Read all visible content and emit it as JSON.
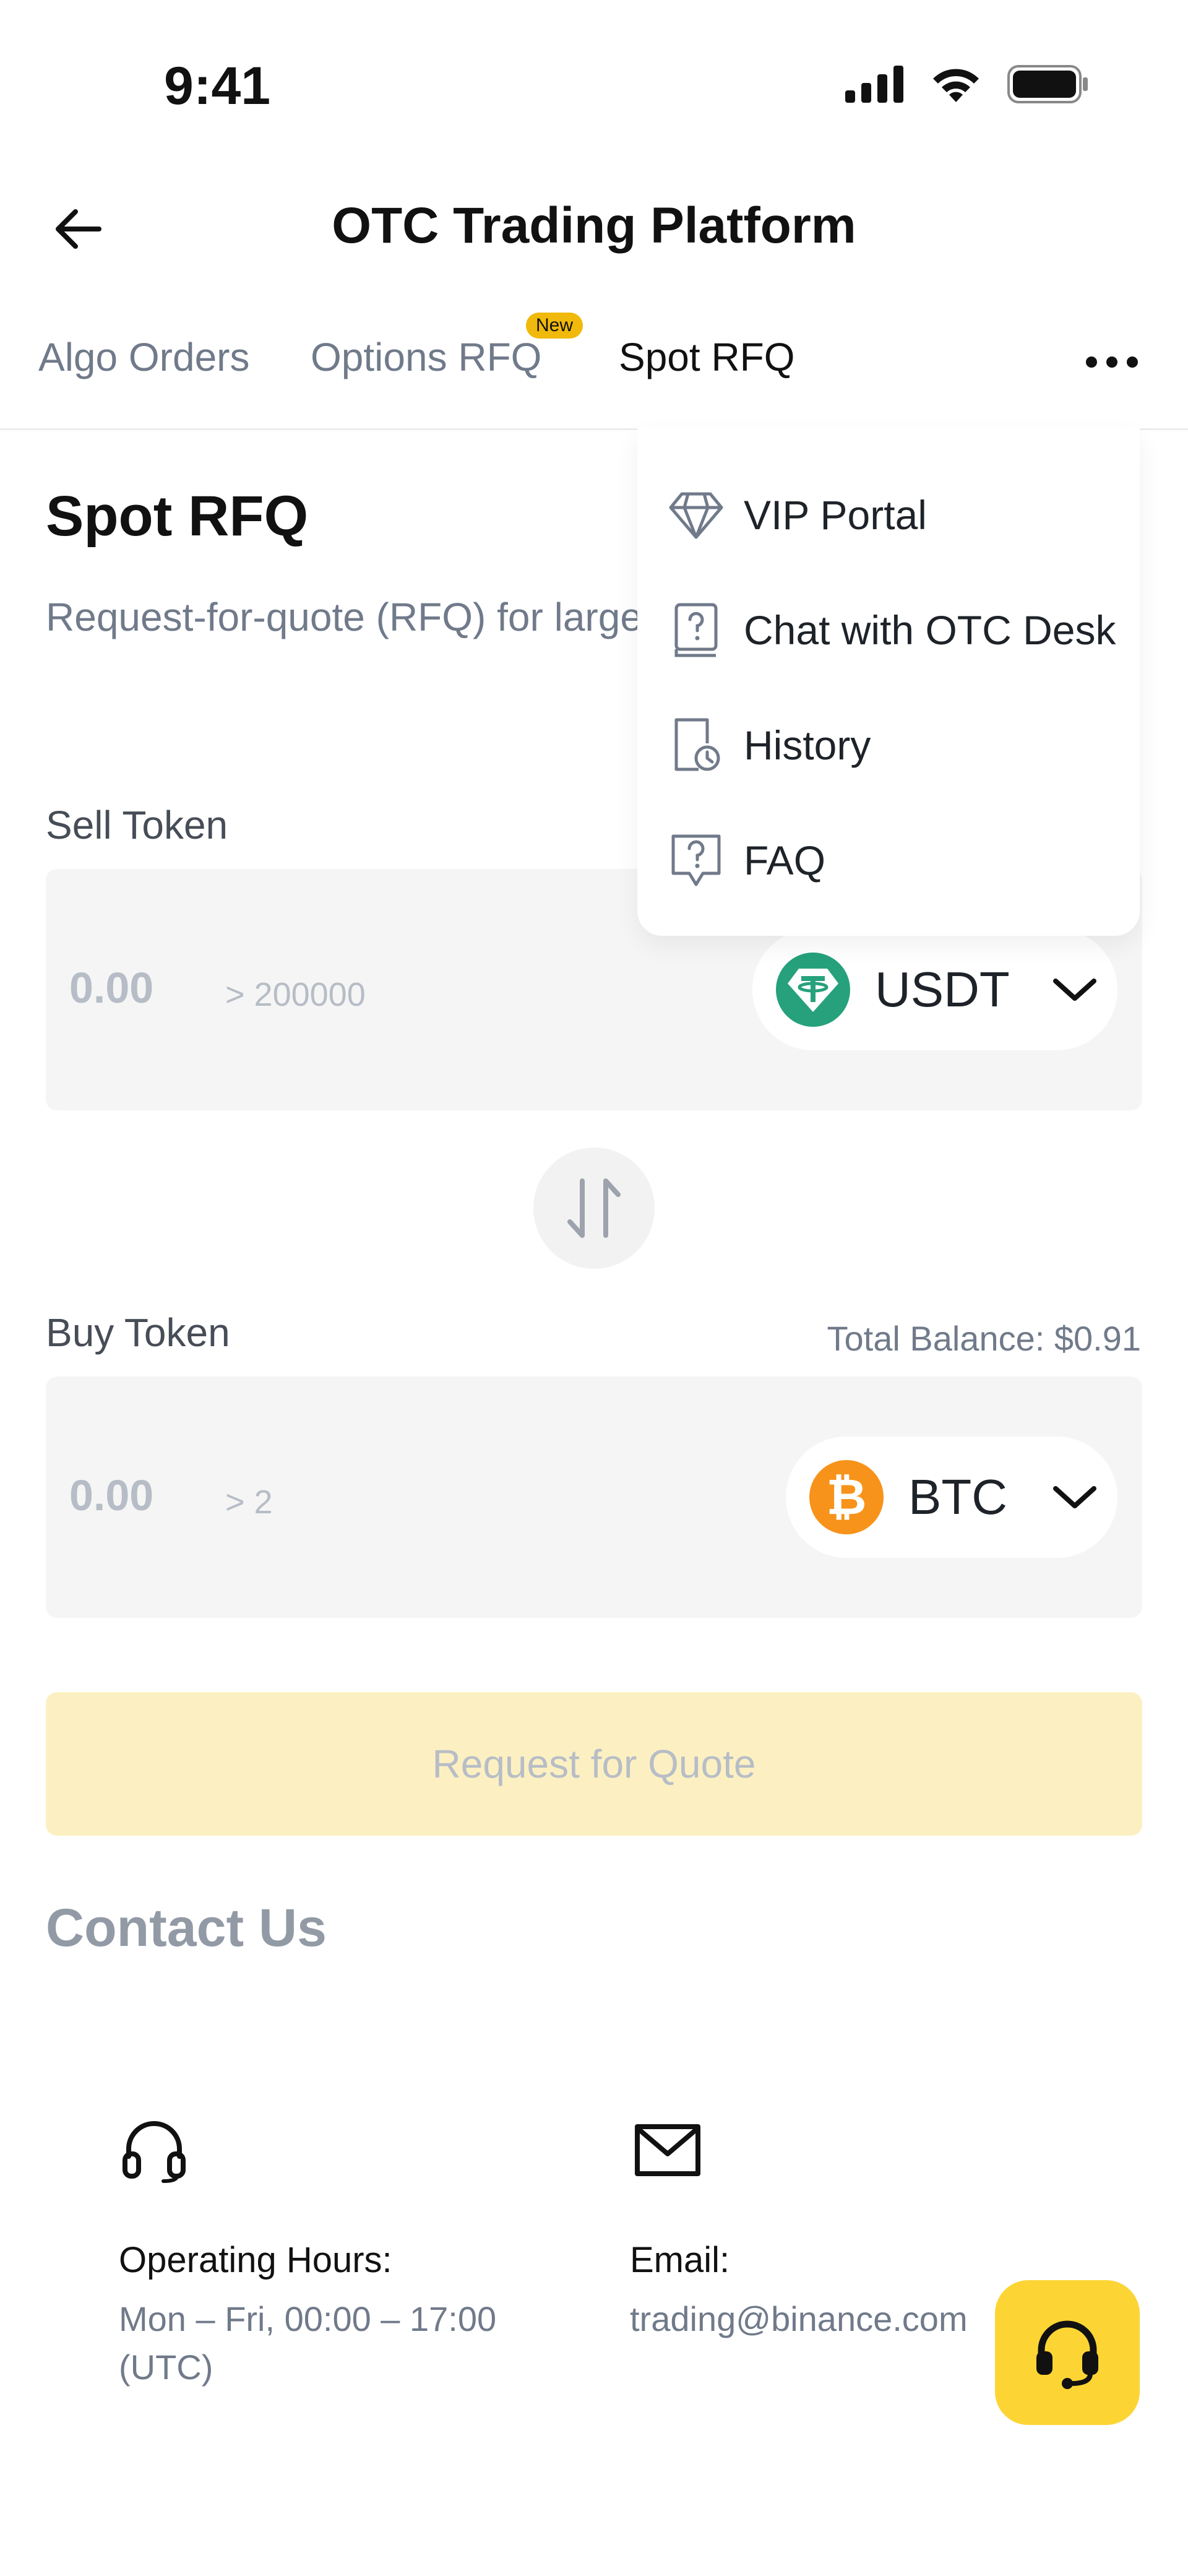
{
  "status_bar": {
    "time": "9:41"
  },
  "header": {
    "title": "OTC Trading Platform"
  },
  "tabs": [
    {
      "label": "Algo Orders"
    },
    {
      "label": "Options RFQ",
      "badge": "New"
    },
    {
      "label": "Spot RFQ"
    }
  ],
  "page": {
    "title": "Spot RFQ",
    "subtitle": "Request-for-quote (RFQ) for large"
  },
  "sell": {
    "label": "Sell Token",
    "amount": "0.00",
    "min_hint": "> 200000",
    "token": "USDT",
    "token_icon": "usdt-icon",
    "token_color": "#26a17b"
  },
  "buy": {
    "label": "Buy Token",
    "balance": "Total Balance: $0.91",
    "amount": "0.00",
    "min_hint": "> 2",
    "token": "BTC",
    "token_icon": "btc-icon",
    "token_color": "#f7931a"
  },
  "rfq_button": "Request for Quote",
  "contact": {
    "title": "Contact Us",
    "hours_label": "Operating Hours:",
    "hours_value_line1": "Mon – Fri, 00:00 – 17:00",
    "hours_value_line2": "(UTC)",
    "email_label": "Email:",
    "email_value": "trading@binance.com"
  },
  "menu": {
    "items": [
      {
        "label": "VIP Portal",
        "icon": "diamond-icon"
      },
      {
        "label": "Chat with OTC Desk",
        "icon": "chat-icon"
      },
      {
        "label": "History",
        "icon": "history-icon"
      },
      {
        "label": "FAQ",
        "icon": "faq-icon"
      }
    ]
  },
  "colors": {
    "accent": "#fcd535",
    "button_disabled": "#fcf0c2"
  }
}
